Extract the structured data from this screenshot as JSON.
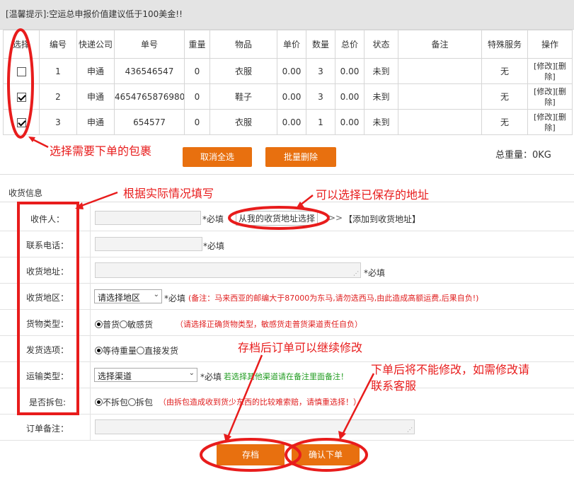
{
  "notice": "[温馨提示]:空运总申报价值建议低于100美金!!",
  "table": {
    "headers": [
      "选择",
      "编号",
      "快递公司",
      "单号",
      "重量",
      "物品",
      "单价",
      "数量",
      "总价",
      "状态",
      "备注",
      "特殊服务",
      "操作"
    ],
    "rows": [
      {
        "checked": false,
        "no": "1",
        "carrier": "申通",
        "tracking": "436546547",
        "weight": "0",
        "item": "衣服",
        "price": "0.00",
        "qty": "3",
        "total": "0.00",
        "status": "未到",
        "note": "",
        "service": "无",
        "ops": "[修改][删除]"
      },
      {
        "checked": true,
        "no": "2",
        "carrier": "申通",
        "tracking": "4654765876980",
        "weight": "0",
        "item": "鞋子",
        "price": "0.00",
        "qty": "3",
        "total": "0.00",
        "status": "未到",
        "note": "",
        "service": "无",
        "ops": "[修改][删除]"
      },
      {
        "checked": true,
        "no": "3",
        "carrier": "申通",
        "tracking": "654577",
        "weight": "0",
        "item": "衣服",
        "price": "0.00",
        "qty": "1",
        "total": "0.00",
        "status": "未到",
        "note": "",
        "service": "无",
        "ops": "[修改][删除]"
      }
    ]
  },
  "buttons": {
    "cancel_all": "取消全选",
    "batch_delete": "批量删除",
    "save": "存档",
    "confirm": "确认下单"
  },
  "total_weight": "总重量：0KG",
  "form": {
    "section_title": "收货信息",
    "receiver_label": "收件人：",
    "required": "*必填",
    "choose_address": "从我的收货地址选择",
    "arrows": ">>",
    "add_address": "【添加到收货地址】",
    "phone_label": "联系电话：",
    "address_label": "收货地址：",
    "region_label": "收货地区：",
    "region_select": "请选择地区",
    "region_note": "(备注：马来西亚的邮编大于87000为东马,请勿选西马,由此造成高额运费,后果自负!)",
    "goods_type_label": "货物类型：",
    "goods_options": [
      "普货",
      "敏感货"
    ],
    "goods_selected": 0,
    "goods_note": "（请选择正确货物类型，敏感货走普货渠道责任自负）",
    "ship_option_label": "发货选项：",
    "ship_options": [
      "等待重量",
      "直接发货"
    ],
    "ship_selected": 0,
    "transport_label": "运输类型：",
    "transport_select": "选择渠道",
    "transport_note": "若选择其他渠道请在备注里面备注！",
    "split_label": "是否拆包:",
    "split_options": [
      "不拆包",
      "拆包"
    ],
    "split_selected": 0,
    "split_note": "（由拆包造成收到货少东西的比较难索赔，请慎重选择！）",
    "remark_label": "订单备注："
  },
  "annotations": {
    "select_packages": "选择需要下单的包裹",
    "fill_actual": "根据实际情况填写",
    "choose_saved": "可以选择已保存的地址",
    "save_editable": "存档后订单可以继续修改",
    "after_order_line1": "下单后将不能修改，如需修改请",
    "after_order_line2": "联系客服"
  },
  "colors": {
    "accent": "#e8700f",
    "annotation": "#e81c1c",
    "notice_bg": "#e4e4e4"
  }
}
